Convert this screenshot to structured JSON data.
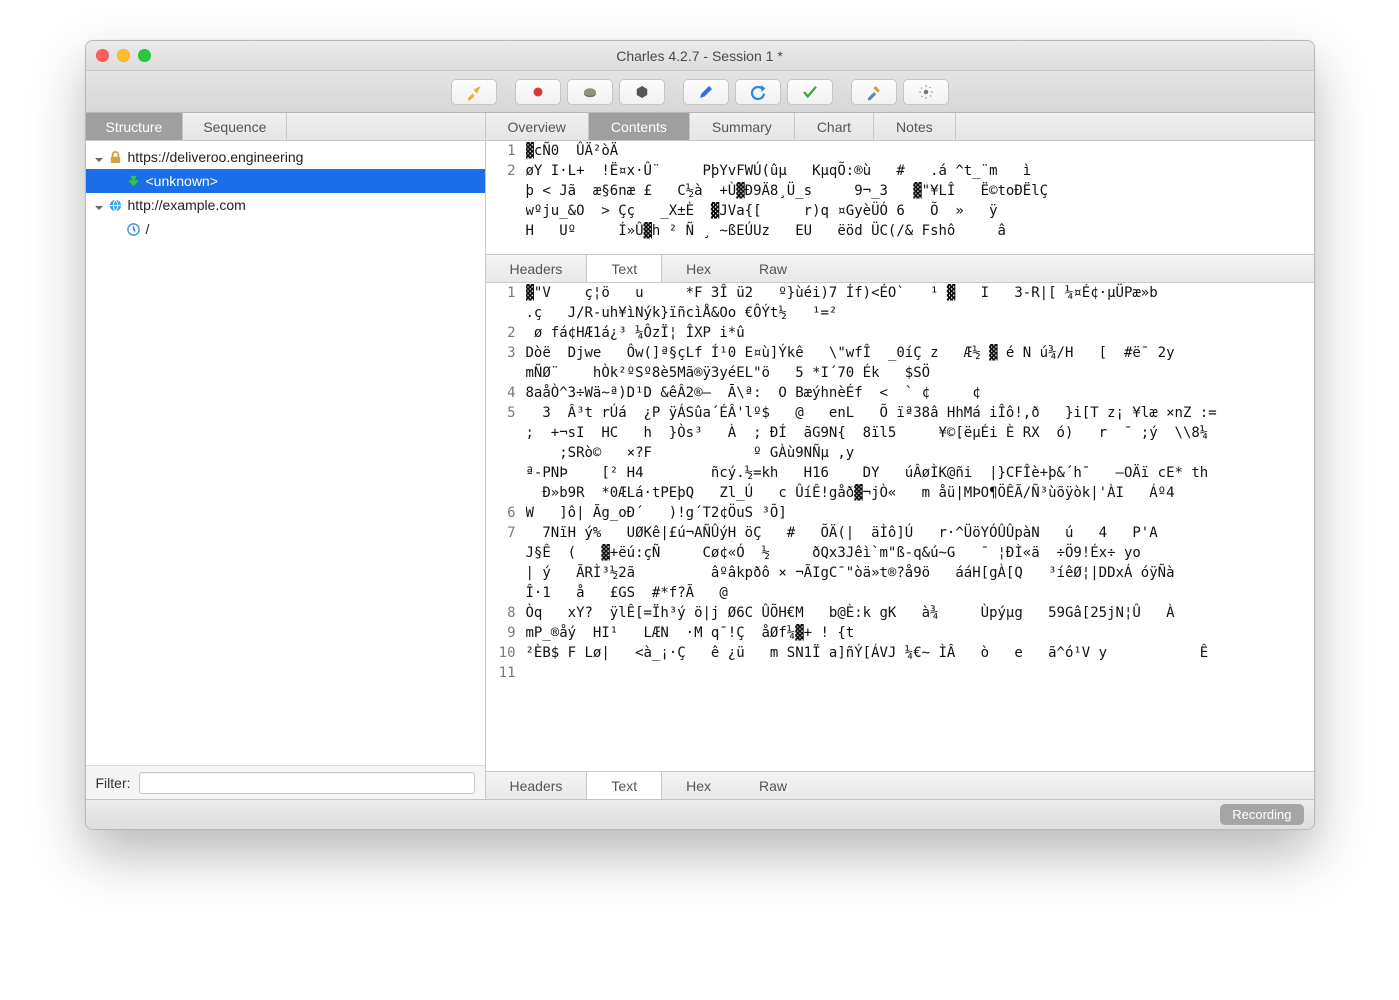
{
  "window": {
    "title": "Charles 4.2.7 - Session 1 *"
  },
  "sidebar": {
    "tabs": [
      "Structure",
      "Sequence"
    ],
    "active": 0,
    "tree": [
      {
        "label": "https://deliveroo.engineering",
        "icon": "lock"
      },
      {
        "label": "<unknown>",
        "icon": "download",
        "selected": true,
        "indent": 1
      },
      {
        "label": "http://example.com",
        "icon": "globe"
      },
      {
        "label": "/",
        "icon": "clock",
        "indent": 1
      }
    ],
    "filter_label": "Filter:",
    "filter_value": ""
  },
  "main": {
    "tabs": [
      "Overview",
      "Contents",
      "Summary",
      "Chart",
      "Notes"
    ],
    "active": 1,
    "sub_tabs": [
      "Headers",
      "Text",
      "Hex",
      "Raw"
    ],
    "sub_active": 1
  },
  "top_block": {
    "gutter": [
      "1",
      "2",
      "",
      "",
      ""
    ],
    "lines": [
      "▓cÑ0  ÛÄ²òÄ",
      "øY I·L+  !Ë¤x·Û¨     PþYvFWÚ(ûµ   KµqÕ:®ù   #   .á ^t_¨m   ì",
      "þ < Jã  æ§6næ £   C½à  +Ù▓Ð9Ä8¸Ü_s     9¬_3   ▓\"¥LÎ   Ë©toÐËlÇ",
      "wºju_&O  > Çç   _X±È  ▓JVa{[     r)q ¤GyèÜÓ 6   Õ  »   ÿ",
      "H   Uº     Í»Û▓h ² Ñ ¸ ~ßEÚUz   EU   ëöd ÜC(/& Fshô     â"
    ]
  },
  "body_block": {
    "gutter": [
      "1",
      "",
      "2",
      "3",
      "",
      "4",
      "5",
      "",
      "",
      "",
      "",
      "6",
      "7",
      "",
      "",
      "",
      "8",
      "9",
      "10",
      "11"
    ],
    "lines": [
      "▓\"V    ç¦ö   u     *F 3Î ü2   º}ùéi)7 Íf)<ÉO`   ¹ ▓   I   3-R|[ ¼¤É¢·µÜPæ»b",
      ".ç   J/R-uh¥ìNýk}ïñcìÅ&Oo €ÔÝt½   ¹=²",
      " ø fá¢HÆ1á¿³ ¼ÔzÏ¦ ÎXP i*û",
      "Dòë  Djwe   Ôw(]ª§çLf Í¹0 E¤ù]Ýkê   \\\"wfÎ  _0íÇ z   Æ½ ▓ é N ú¾/H   [  #ë¯ 2y",
      "mÑØ¨    hÒk²ºSº8è5Mã®ÿ3yéEL\"ö   5 *I´70 Ék   $SÖ",
      "8aåÒ^3÷Wä~ª)D¹D &êÂ2®–  Ā\\ª:  O BæýhnèÉf  <  ` ¢     ¢",
      "  3  Â³t rÚá  ¿P ÿÁSûa´ÉÂ'lº$   @   enL   Õ ïª38â HhMá iÎô!,ð   }i[T z¡ ¥læ ×nZ :=",
      ";  +¬sI  HC   h  }Òs³   À  ; ÐÍ  ãG9N{  8ïl5     ¥©[ëµÉi È RX  ó)   r  ¯ ;ý  \\\\8¼",
      "    ;SRò©   ×?F            º GÀù9NÑµ ,y",
      "ª-PNÞ    [² H4        ñcý.½=kh   H16    DY   úÂøÌK@ñi  |}CFÎè+þ&´h¯   –OÄï cE* th",
      "  Ð»b9R  *0ÆLá·tPEþQ   Zl_Ú   c ÛíÊ!gåð▓¬jÒ«   m åü|MÞO¶ÖÊÃ/Ñ³ùõÿòk|'ÀI   Áº4",
      "W   ]ô| Ãg_oÐ´   )!g´T2¢ÖuS ³Õ]",
      "  7NïH ý%   UØKê|£ú¬AÑÛýH öÇ   #   ÕÄ(|  äÌô]Ú   r·^ÜöYÓÛÛpàN   ú   4   P'A",
      "J§Ê  (   ▓+ëú:çÑ     Cø¢«Ó  ½     ðQx3Jêì`m\"ß-q&ú~G   ¯ ¦ÐÌ«ä  ÷Ö9!Éx÷ yo",
      "| ý   ÃRÌ³½2ã         âºâkpðô × ¬ÃIgC¯\"òä»t®?å9ö   ááH[gÀ[Q   ³íêØ¦|DDxÁ óÿÑà",
      "Î·1   å   £GS  #*f?Ã   @",
      "Òq   xY?  ÿlÊ[=Ïh³ý ö|j Ø6C ÛÕH€M   b@È:k gK   à¾     Ùpýµg   59Gâ[25jN¦Û   À",
      "mP_®åý  HI¹   LÆN  ·M q¯!Ç  åØf¼▓+ ! {t",
      "²ÈB$ F Lø|   <à_¡·Ç   ê ¿ü   m SN1Ï a]ñÝ[ÁVJ ¼€~ ÌÂ   ò   e   ã^ó¹V y           Ê",
      ""
    ]
  },
  "status": {
    "label": "Recording"
  }
}
